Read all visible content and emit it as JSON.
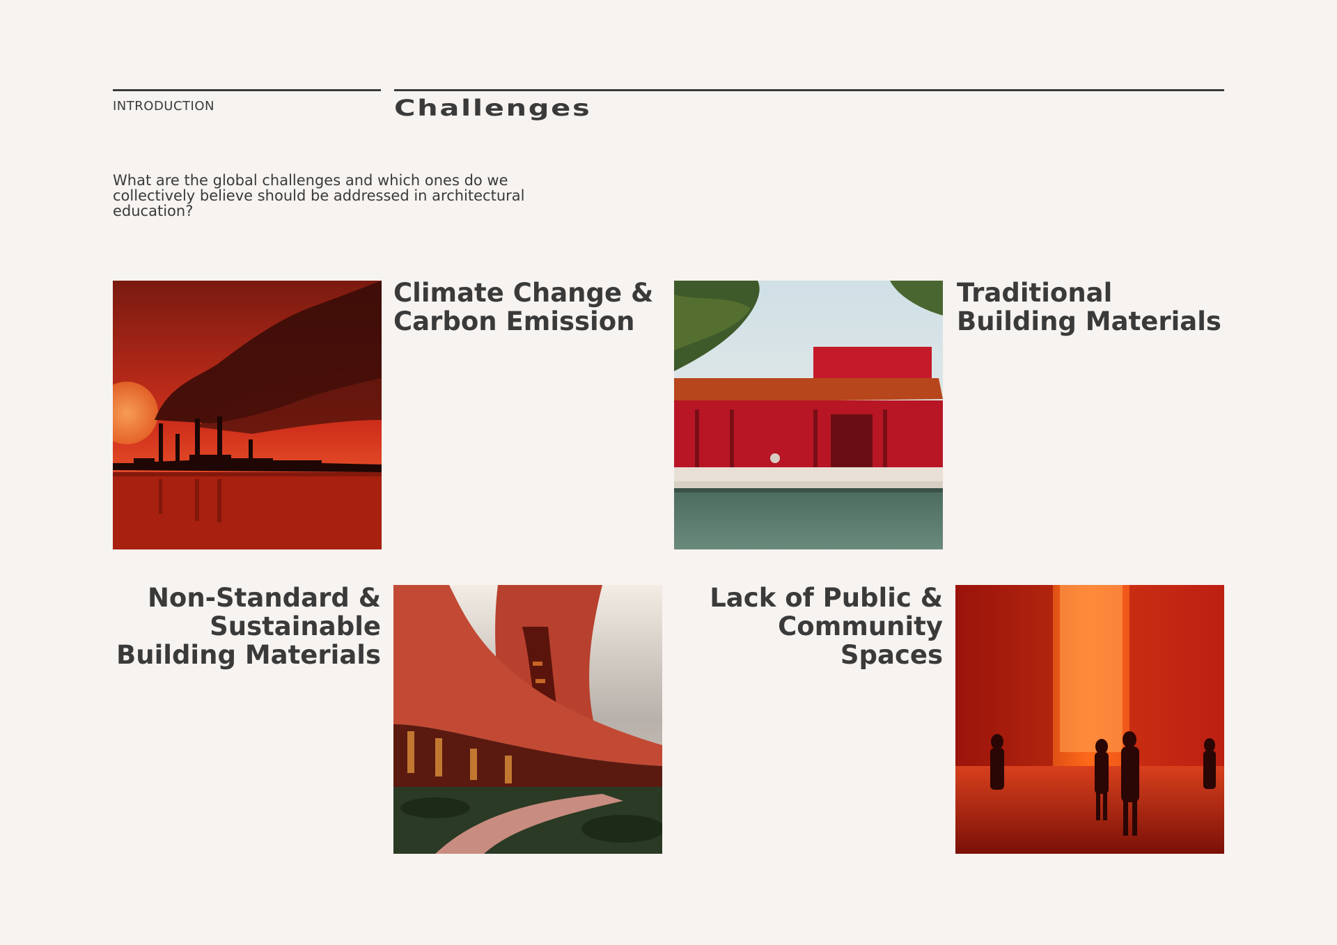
{
  "header": {
    "section": "INTRODUCTION",
    "title": "Challenges"
  },
  "intro": {
    "question": "What are the global challenges and which ones do we collectively believe should be addressed in architectural education?"
  },
  "challenges": [
    {
      "title": "Climate Change &\nCarbon Emission",
      "image": "factory-smoke-sunset"
    },
    {
      "title": "Traditional\nBuilding Materials",
      "image": "red-courtyard-house"
    },
    {
      "title": "Non-Standard &\nSustainable\nBuilding Materials",
      "image": "curved-red-building"
    },
    {
      "title": "Lack of Public &\nCommunity\nSpaces",
      "image": "red-corridor-people"
    }
  ],
  "colors": {
    "background": "#f7f3f0",
    "text": "#3a3a3a",
    "accent_red": "#c8261a"
  }
}
